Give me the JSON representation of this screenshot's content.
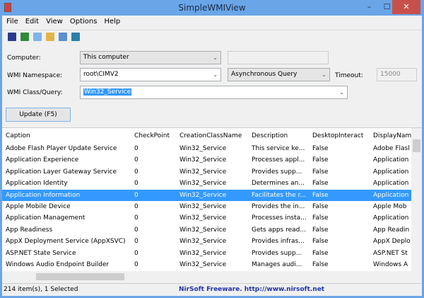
{
  "window": {
    "title": "SimpleWMIView",
    "minimize": "–",
    "maximize": "☐",
    "close": "✕"
  },
  "menu": [
    "File",
    "Edit",
    "View",
    "Options",
    "Help"
  ],
  "toolbar": [
    "save-icon",
    "refresh-icon",
    "copy-icon",
    "properties-icon",
    "find-icon",
    "exit-icon"
  ],
  "form": {
    "computer_label": "Computer:",
    "computer_value": "This computer",
    "computer_name": "",
    "namespace_label": "WMI Namespace:",
    "namespace_value": "root\\CIMV2",
    "query_mode": "Asynchronous Query",
    "timeout_label": "Timeout:",
    "timeout_value": "15000",
    "class_label": "WMI Class/Query:",
    "class_value": "Win32_Service",
    "update_button": "Update (F5)"
  },
  "table": {
    "columns": [
      "Caption",
      "CheckPoint",
      "CreationClassName",
      "Description",
      "DesktopInteract",
      "DisplayNam"
    ],
    "rows": [
      [
        "Adobe Flash Player Update Service",
        "0",
        "Win32_Service",
        "This service ke...",
        "False",
        "Adobe Flasl"
      ],
      [
        "Application Experience",
        "0",
        "Win32_Service",
        "Processes appl...",
        "False",
        "Application"
      ],
      [
        "Application Layer Gateway Service",
        "0",
        "Win32_Service",
        "Provides supp...",
        "False",
        "Application"
      ],
      [
        "Application Identity",
        "0",
        "Win32_Service",
        "Determines an...",
        "False",
        "Application"
      ],
      [
        "Application Information",
        "0",
        "Win32_Service",
        "Facilitates the r...",
        "False",
        "Application"
      ],
      [
        "Apple Mobile Device",
        "0",
        "Win32_Service",
        "Provides the in...",
        "False",
        "Apple Mob"
      ],
      [
        "Application Management",
        "0",
        "Win32_Service",
        "Processes insta...",
        "False",
        "Application"
      ],
      [
        "App Readiness",
        "0",
        "Win32_Service",
        "Gets apps read...",
        "False",
        "App Readin"
      ],
      [
        "AppX Deployment Service (AppXSVC)",
        "0",
        "Win32_Service",
        "Provides infras...",
        "False",
        "AppX Deplo"
      ],
      [
        "ASP.NET State Service",
        "0",
        "Win32_Service",
        "Provides supp...",
        "False",
        "ASP.NET St"
      ],
      [
        "Windows Audio Endpoint Builder",
        "0",
        "Win32_Service",
        "Manages audi...",
        "False",
        "Windows A"
      ]
    ],
    "selected_index": 4
  },
  "status": {
    "count": "214 item(s), 1 Selected",
    "credit": "NirSoft Freeware.  http://www.nirsoft.net"
  }
}
